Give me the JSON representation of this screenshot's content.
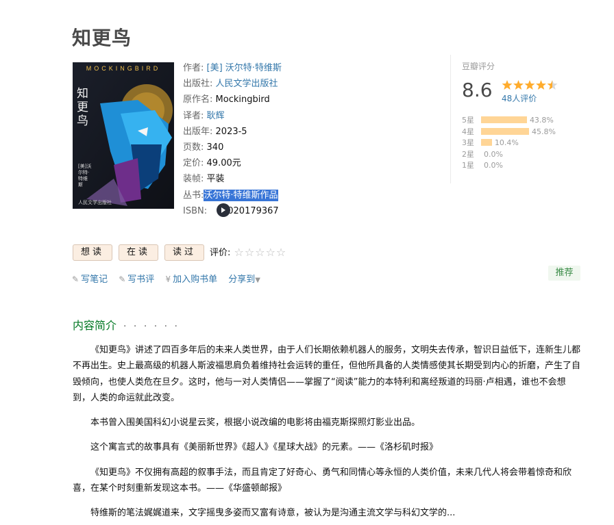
{
  "book": {
    "title": "知更鸟",
    "cover": {
      "brand": "MOCKINGBIRD",
      "title_cn": "知更鸟",
      "author_small": "[美]沃尔特·特维斯",
      "publisher_mark": "人民文学出版社"
    },
    "info": {
      "author_label": "作者:",
      "author": "[美] 沃尔特·特维斯",
      "publisher_label": "出版社:",
      "publisher": "人民文学出版社",
      "original_title_label": "原作名:",
      "original_title": "Mockingbird",
      "translator_label": "译者:",
      "translator": "耿辉",
      "year_label": "出版年:",
      "year": "2023-5",
      "pages_label": "页数:",
      "pages": "340",
      "price_label": "定价:",
      "price": "49.00元",
      "binding_label": "装帧:",
      "binding": "平装",
      "series_label": "丛书:",
      "series": "沃尔特·特维斯作品",
      "isbn_label": "ISBN:",
      "isbn_visible": "020179367"
    }
  },
  "rating": {
    "header": "豆瓣评分",
    "score": "8.6",
    "stars_value": 4.5,
    "count": "48人评价",
    "distribution": [
      {
        "level": "5星",
        "percent": "43.8%",
        "value": 43.8
      },
      {
        "level": "4星",
        "percent": "45.8%",
        "value": 45.8
      },
      {
        "level": "3星",
        "percent": "10.4%",
        "value": 10.4
      },
      {
        "level": "2星",
        "percent": "0.0%",
        "value": 0
      },
      {
        "level": "1星",
        "percent": "0.0%",
        "value": 0
      }
    ],
    "colors": {
      "star": "#ffac2d",
      "bar": "#ffd596"
    }
  },
  "actions": {
    "want": "想读",
    "reading": "在读",
    "read": "读过",
    "my_rating_label": "评价:"
  },
  "links": {
    "write_note": "写笔记",
    "write_review": "写书评",
    "cart": "加入购书单",
    "share": "分享到"
  },
  "recommend": "推荐",
  "intro": {
    "title": "内容简介",
    "dots": "· · · · · ·",
    "paragraphs": [
      "《知更鸟》讲述了四百多年后的未来人类世界，由于人们长期依赖机器人的服务，文明失去传承，智识日益低下，连新生儿都不再出生。史上最高级的机器人斯波福思肩负着维持社会运转的重任，但他所具备的人类情感使其长期受到内心的折磨，产生了自毁倾向，也使人类危在旦夕。这时，他与一对人类情侣——掌握了“阅读”能力的本特利和离经叛道的玛丽·卢相遇，谁也不会想到，人类的命运就此改变。",
      "本书曾入围美国科幻小说星云奖，根据小说改编的电影将由福克斯探照灯影业出品。",
      "这个寓言式的故事具有《美丽新世界》《超人》《星球大战》的元素。——《洛杉矶时报》",
      "《知更鸟》不仅拥有高超的叙事手法，而且肯定了好奇心、勇气和同情心等永恒的人类价值，未来几代人将会带着惊奇和欣喜，在某个时刻重新发现这本书。——《华盛顿邮报》",
      "特维斯的笔法娓娓道来，文字摇曳多姿而又富有诗意，被认为是沟通主流文学与科幻文学的..."
    ]
  }
}
